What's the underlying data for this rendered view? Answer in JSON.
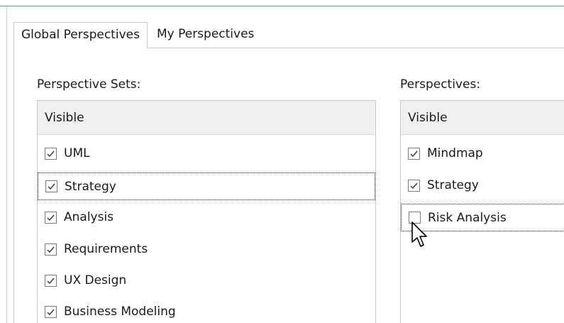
{
  "tabs": [
    {
      "label": "Global Perspectives",
      "active": true
    },
    {
      "label": "My Perspectives",
      "active": false
    }
  ],
  "perspective_sets": {
    "label": "Perspective Sets:",
    "column_header": "Visible",
    "items": [
      {
        "label": "UML",
        "checked": true
      },
      {
        "label": "Strategy",
        "checked": true,
        "focused": true
      },
      {
        "label": "Analysis",
        "checked": true
      },
      {
        "label": "Requirements",
        "checked": true
      },
      {
        "label": "UX Design",
        "checked": true
      },
      {
        "label": "Business Modeling",
        "checked": true
      }
    ]
  },
  "perspectives": {
    "label": "Perspectives:",
    "column_header": "Visible",
    "items": [
      {
        "label": "Mindmap",
        "checked": true
      },
      {
        "label": "Strategy",
        "checked": true
      },
      {
        "label": "Risk Analysis",
        "checked": false,
        "focused": true
      }
    ]
  },
  "colors": {
    "accent_border": "#6e8db5",
    "header_bg": "#f0f0f0"
  }
}
